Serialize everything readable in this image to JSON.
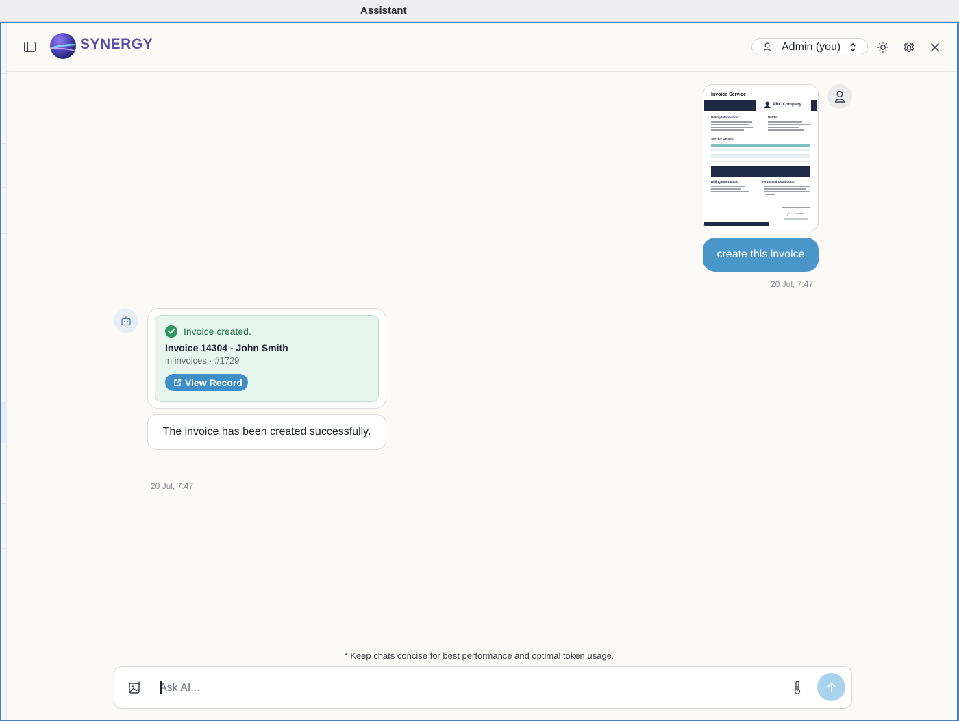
{
  "window": {
    "title": "Assistant"
  },
  "header": {
    "logo_text": "SYNERGY",
    "user_select": {
      "value": "Admin (you)"
    }
  },
  "conversation": {
    "user_message": {
      "attachment": {
        "doc_title": "Invoice Service",
        "company": "ABC Company",
        "labels": [
          "Billing Information:",
          "Bill To:",
          "Service Details:",
          "Billing Information:",
          "Terms and Conditions:"
        ]
      },
      "text": "create this invoice",
      "timestamp": "20 Jul, 7:47"
    },
    "bot_card": {
      "status": "Invoice created.",
      "title": "Invoice 14304 - John Smith",
      "subtitle": "in invoices · #1729",
      "button_label": "View Record"
    },
    "bot_message": {
      "text": "The invoice has been created successfully.",
      "timestamp": "20 Jul, 7:47"
    }
  },
  "composer": {
    "hint": "* Keep chats concise for best performance and optimal token usage.",
    "placeholder": "Ask AI..."
  },
  "colors": {
    "accent": "#4b96c9",
    "success_bg": "#e6f6ef",
    "success_text": "#23734c",
    "brand": "#5d4fa8"
  },
  "icons": [
    "sidebar-toggle-icon",
    "user-icon",
    "chevron-updown-icon",
    "sun-icon",
    "gear-icon",
    "close-icon",
    "bot-icon",
    "check-circle-icon",
    "external-link-icon",
    "image-add-icon",
    "thermometer-icon",
    "arrow-up-icon"
  ]
}
